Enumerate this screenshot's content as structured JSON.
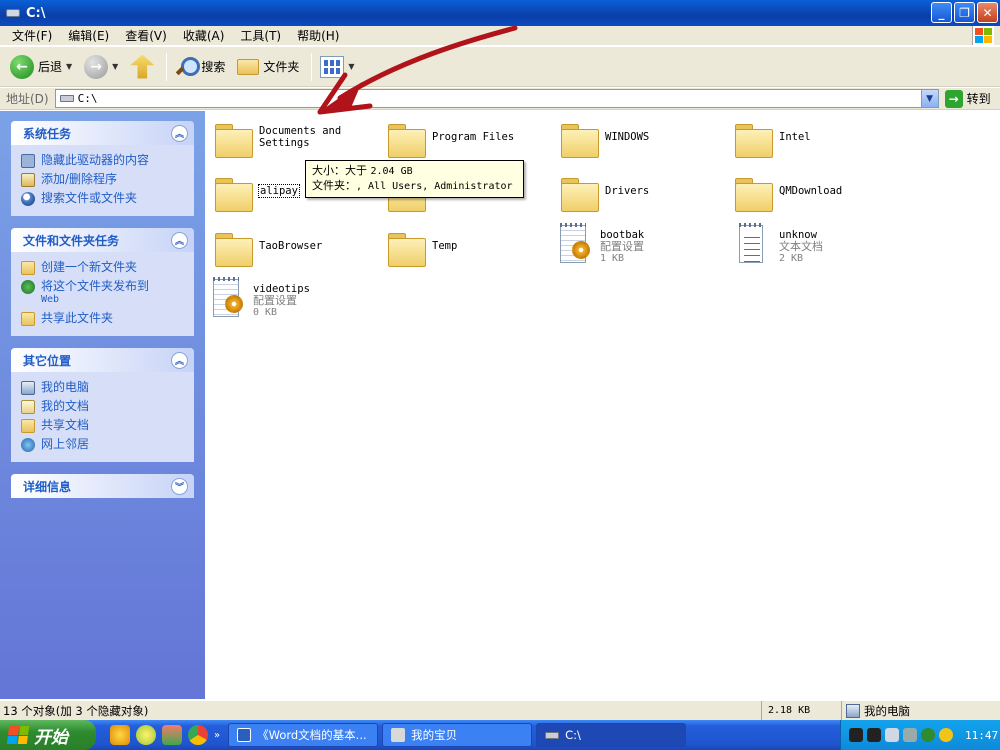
{
  "window": {
    "title": "C:\\"
  },
  "menu": [
    "文件(F)",
    "编辑(E)",
    "查看(V)",
    "收藏(A)",
    "工具(T)",
    "帮助(H)"
  ],
  "toolbar": {
    "back_label": "后退",
    "search_label": "搜索",
    "folders_label": "文件夹"
  },
  "address": {
    "label": "地址(D)",
    "value": "C:\\",
    "go_label": "转到"
  },
  "left_pane": {
    "system_tasks": {
      "title": "系统任务",
      "items": [
        "隐藏此驱动器的内容",
        "添加/删除程序",
        "搜索文件或文件夹"
      ]
    },
    "file_tasks": {
      "title": "文件和文件夹任务",
      "items": [
        "创建一个新文件夹",
        "将这个文件夹发布到",
        "Web",
        "共享此文件夹"
      ]
    },
    "other_places": {
      "title": "其它位置",
      "items": [
        "我的电脑",
        "我的文档",
        "共享文档",
        "网上邻居"
      ]
    },
    "details": {
      "title": "详细信息"
    }
  },
  "files": [
    {
      "name": "Documents and",
      "name2": "Settings",
      "type": "folder"
    },
    {
      "name": "Program Files",
      "type": "folder"
    },
    {
      "name": "WINDOWS",
      "type": "folder"
    },
    {
      "name": "Intel",
      "type": "folder"
    },
    {
      "name": "alipay",
      "type": "folder"
    },
    {
      "name": "Drivers",
      "type": "folder"
    },
    {
      "name": "QMDownload",
      "type": "folder"
    },
    {
      "name": "TaoBrowser",
      "type": "folder"
    },
    {
      "name": "Temp",
      "type": "folder"
    },
    {
      "name": "bootbak",
      "kind": "配置设置",
      "size": "1 KB",
      "type": "config"
    },
    {
      "name": "unknow",
      "kind": "文本文档",
      "size": "2 KB",
      "type": "text"
    },
    {
      "name": "videotips",
      "kind": "配置设置",
      "size": "0 KB",
      "type": "config"
    }
  ],
  "tooltip": {
    "line1_label": "大小：大于 ",
    "line1_value": "2.04 GB",
    "line2_label": "文件夹：",
    "line2_value": ", All Users, Administrator"
  },
  "status": {
    "left": "13 个对象(加 3 个隐藏对象)",
    "size": "2.18 KB",
    "location": "我的电脑"
  },
  "taskbar": {
    "start_label": "开始",
    "tasks": [
      "《Word文档的基本...",
      "我的宝贝",
      "C:\\"
    ],
    "clock": "11:47"
  },
  "colors": {
    "accent": "#215dc6",
    "annotation_arrow": "#b0141a"
  }
}
